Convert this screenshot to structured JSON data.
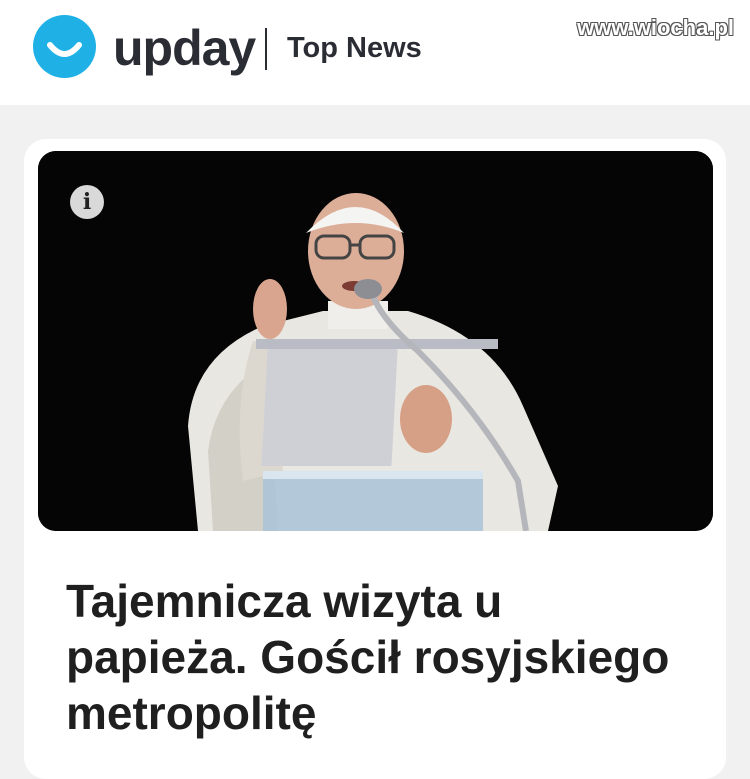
{
  "header": {
    "brand": "upday",
    "section": "Top News",
    "logo_color": "#1fb1e6"
  },
  "watermark": "www.wiocha.pl",
  "article": {
    "image_alt": "Pope at a lectern with microphone",
    "info_label": "i",
    "headline": "Tajemnicza wizyta u papieża. Gościł rosyjskiego metropolitę"
  },
  "icons": {
    "logo": "smile-icon",
    "info": "info-icon"
  }
}
